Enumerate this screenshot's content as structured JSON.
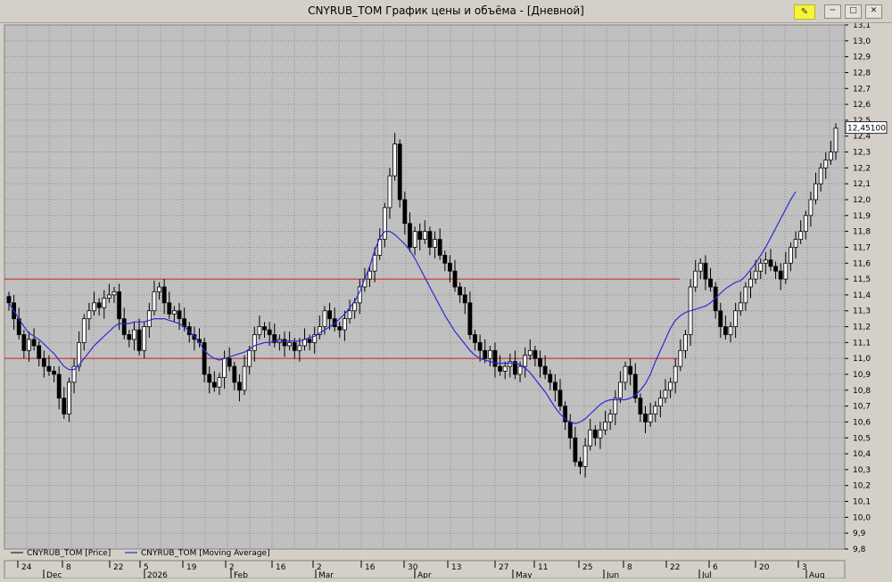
{
  "window": {
    "title": "CNYRUB_TOM График цены и объёма - [Дневной]",
    "buttons": [
      "minimize",
      "restore",
      "close"
    ]
  },
  "price_marker": "12,45100",
  "legend": [
    "CNYRUB_TOM [Price]",
    "CNYRUB_TOM [Moving Average]"
  ],
  "x_day_ticks": [
    "24",
    "8",
    "22",
    "5",
    "19",
    "2",
    "16",
    "2",
    "16",
    "30",
    "13",
    "27",
    "11",
    "25",
    "8",
    "22",
    "6",
    "20",
    "3"
  ],
  "x_month_ticks": [
    "Dec",
    "2026",
    "Feb",
    "Mar",
    "Apr",
    "May",
    "Jun",
    "Jul",
    "Aug"
  ],
  "colors": {
    "background": "#c0c0c0",
    "grid": "#8c8c8c",
    "candle": "#000000",
    "moving_average": "#2b2bd8",
    "level_line": "#d02020"
  },
  "chart_data": {
    "type": "candlestick",
    "title": "CNYRUB_TOM",
    "ylim": [
      9.8,
      13.1
    ],
    "y_ticks": [
      "13,1",
      "13,0",
      "12,9",
      "12,8",
      "12,7",
      "12,6",
      "12,5",
      "12,4",
      "12,3",
      "12,2",
      "12,1",
      "12,0",
      "11,9",
      "11,8",
      "11,7",
      "11,6",
      "11,5",
      "11,4",
      "11,3",
      "11,2",
      "11,1",
      "11,0",
      "10,9",
      "10,8",
      "10,7",
      "10,6",
      "10,5",
      "10,4",
      "10,3",
      "10,2",
      "10,1",
      "10,0",
      "9,9",
      "9,8"
    ],
    "horizontal_levels": [
      11.5,
      11.0
    ],
    "last_price": 12.451,
    "series": [
      {
        "name": "CNYRUB_TOM [Price]",
        "close": [
          11.35,
          11.25,
          11.15,
          11.05,
          11.12,
          11.08,
          11.0,
          10.95,
          10.92,
          10.9,
          10.75,
          10.65,
          10.85,
          10.95,
          11.1,
          11.25,
          11.3,
          11.35,
          11.32,
          11.38,
          11.4,
          11.42,
          11.25,
          11.15,
          11.12,
          11.18,
          11.05,
          11.2,
          11.3,
          11.42,
          11.45,
          11.35,
          11.28,
          11.3,
          11.25,
          11.2,
          11.15,
          11.12,
          11.1,
          10.9,
          10.85,
          10.82,
          10.88,
          11.0,
          10.95,
          10.85,
          10.8,
          10.95,
          11.05,
          11.15,
          11.2,
          11.18,
          11.15,
          11.1,
          11.12,
          11.08,
          11.1,
          11.05,
          11.08,
          11.12,
          11.1,
          11.15,
          11.2,
          11.3,
          11.25,
          11.2,
          11.18,
          11.25,
          11.3,
          11.35,
          11.45,
          11.5,
          11.55,
          11.65,
          11.75,
          11.95,
          12.15,
          12.35,
          12.0,
          11.85,
          11.7,
          11.8,
          11.75,
          11.8,
          11.7,
          11.75,
          11.65,
          11.6,
          11.55,
          11.45,
          11.4,
          11.35,
          11.15,
          11.1,
          11.05,
          11.0,
          11.05,
          10.95,
          10.92,
          10.95,
          10.98,
          10.9,
          10.95,
          11.02,
          11.05,
          11.0,
          10.95,
          10.9,
          10.85,
          10.8,
          10.7,
          10.6,
          10.5,
          10.35,
          10.32,
          10.45,
          10.55,
          10.5,
          10.55,
          10.6,
          10.65,
          10.75,
          10.85,
          10.95,
          10.9,
          10.75,
          10.65,
          10.6,
          10.65,
          10.7,
          10.75,
          10.8,
          10.85,
          10.95,
          11.05,
          11.15,
          11.45,
          11.55,
          11.6,
          11.5,
          11.45,
          11.3,
          11.2,
          11.15,
          11.2,
          11.3,
          11.35,
          11.45,
          11.5,
          11.55,
          11.6,
          11.62,
          11.58,
          11.55,
          11.5,
          11.6,
          11.7,
          11.75,
          11.8,
          11.9,
          12.0,
          12.1,
          12.2,
          12.25,
          12.3,
          12.45
        ]
      },
      {
        "name": "CNYRUB_TOM [Moving Average]",
        "values": [
          11.35,
          11.3,
          11.25,
          11.2,
          11.16,
          11.14,
          11.12,
          11.09,
          11.06,
          11.03,
          10.99,
          10.95,
          10.93,
          10.93,
          10.96,
          11.0,
          11.04,
          11.08,
          11.11,
          11.14,
          11.17,
          11.2,
          11.22,
          11.22,
          11.22,
          11.23,
          11.23,
          11.23,
          11.24,
          11.25,
          11.25,
          11.25,
          11.24,
          11.23,
          11.22,
          11.2,
          11.17,
          11.14,
          11.1,
          11.05,
          11.02,
          11.0,
          10.99,
          11.0,
          11.01,
          11.02,
          11.03,
          11.04,
          11.06,
          11.08,
          11.09,
          11.1,
          11.1,
          11.11,
          11.11,
          11.11,
          11.11,
          11.11,
          11.11,
          11.12,
          11.13,
          11.14,
          11.16,
          11.18,
          11.2,
          11.22,
          11.25,
          11.28,
          11.32,
          11.36,
          11.42,
          11.5,
          11.58,
          11.68,
          11.76,
          11.8,
          11.8,
          11.78,
          11.75,
          11.72,
          11.68,
          11.63,
          11.57,
          11.51,
          11.45,
          11.39,
          11.33,
          11.27,
          11.22,
          11.17,
          11.13,
          11.09,
          11.05,
          11.02,
          11.0,
          10.99,
          10.98,
          10.97,
          10.97,
          10.97,
          10.97,
          10.97,
          10.96,
          10.94,
          10.91,
          10.87,
          10.83,
          10.79,
          10.74,
          10.69,
          10.65,
          10.62,
          10.6,
          10.59,
          10.6,
          10.62,
          10.65,
          10.68,
          10.71,
          10.73,
          10.74,
          10.74,
          10.74,
          10.74,
          10.75,
          10.77,
          10.8,
          10.84,
          10.9,
          10.98,
          11.05,
          11.12,
          11.19,
          11.24,
          11.27,
          11.29,
          11.3,
          11.31,
          11.32,
          11.33,
          11.35,
          11.38,
          11.41,
          11.44,
          11.46,
          11.48,
          11.49,
          11.52,
          11.56,
          11.6,
          11.65,
          11.7,
          11.76,
          11.82,
          11.88,
          11.94,
          12.0,
          12.05
        ]
      }
    ]
  }
}
